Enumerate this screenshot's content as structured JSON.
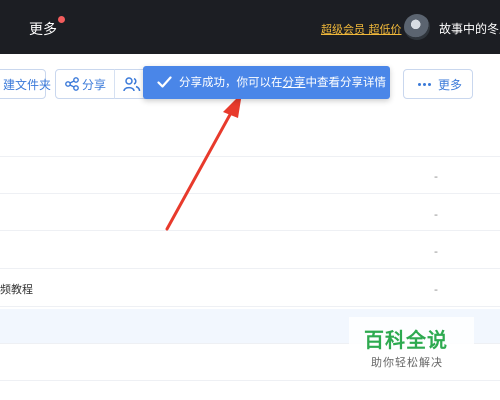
{
  "topbar": {
    "more_label": "更多",
    "vip_link": "超级会员 超低价",
    "username": "故事中的冬瓜"
  },
  "toolbar": {
    "new_folder_label": "建文件夹",
    "share_label": "分享",
    "more_label": "更多"
  },
  "toast": {
    "message_before": "分享成功，你可以在",
    "message_link": "分享",
    "message_after": "中查看分享详情"
  },
  "list": {
    "rows": [
      {
        "name": "",
        "modified": "-"
      },
      {
        "name": "",
        "modified": "-"
      },
      {
        "name": "",
        "modified": "-"
      },
      {
        "name": "频教程",
        "modified": "-"
      }
    ]
  },
  "watermark": {
    "title": "百科全说",
    "subtitle": "助你轻松解决"
  },
  "colors": {
    "topbar_bg": "#1c1e23",
    "toast_bg": "#4a86e8",
    "accent_blue": "#3b7ad9",
    "vip_gold": "#f0b83a",
    "annotation_red": "#e83a2c",
    "watermark_green": "#2eaa50"
  }
}
